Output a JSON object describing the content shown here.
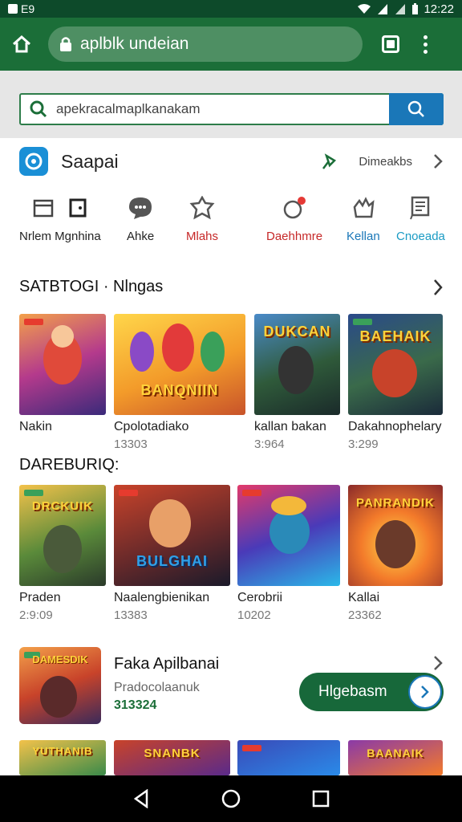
{
  "status_bar": {
    "left_text": "E9",
    "time": "12:22"
  },
  "browser": {
    "url": "aplblk undeian"
  },
  "search": {
    "query": "apekracalmaplkanakam"
  },
  "app_header": {
    "name": "Saapai",
    "action_label": "Dimeakbs"
  },
  "categories": [
    {
      "label": "Nrlem Mgnhina",
      "icon": "calendar-icon",
      "color": "#222222"
    },
    {
      "label": "Ahke",
      "icon": "chat-icon",
      "color": "#222222"
    },
    {
      "label": "Mlahs",
      "icon": "puzzle-icon",
      "color": "#c62828"
    },
    {
      "label": "Daehhmre",
      "icon": "notification-icon",
      "color": "#c62828"
    },
    {
      "label": "Kellan",
      "icon": "hand-icon",
      "color": "#1a77b8"
    },
    {
      "label": "Cnoeada",
      "icon": "document-icon",
      "color": "#1a9bc4"
    }
  ],
  "section1": {
    "title": "SATBTOGI · Nlngas",
    "items": [
      {
        "name": "Nakin",
        "value": ""
      },
      {
        "name": "Cpolotadiako",
        "value": "13303"
      },
      {
        "name": "kallan bakan",
        "value": "3:964"
      },
      {
        "name": "Dakahnophelary",
        "value": "3:299"
      }
    ],
    "overlays": [
      "",
      "BANQNIIN",
      "DUKCAN",
      "BAEHAIK"
    ]
  },
  "section2": {
    "title": "DAREBURIQ:",
    "items": [
      {
        "name": "Praden",
        "value": "2:9:09"
      },
      {
        "name": "Naalengbienikan",
        "value": "13383"
      },
      {
        "name": "Cerobrii",
        "value": "10202"
      },
      {
        "name": "Kallai",
        "value": "23362"
      }
    ],
    "overlays": [
      "DRCKUIK",
      "BULGHAI",
      "",
      "PANRANDIK"
    ]
  },
  "featured": {
    "title": "Faka Apilbanai",
    "subtitle": "Pradocolaanuk",
    "value": "313324",
    "overlay": "DAMESDIK",
    "button_label": "Hlgebasm"
  },
  "bottom_row_overlays": [
    "YUTHANIB",
    "SNANBK",
    "",
    "BAANAIK"
  ],
  "colors": {
    "toolbar": "#1b6e38",
    "status": "#0d4a2a",
    "accent": "#1a77b8"
  }
}
